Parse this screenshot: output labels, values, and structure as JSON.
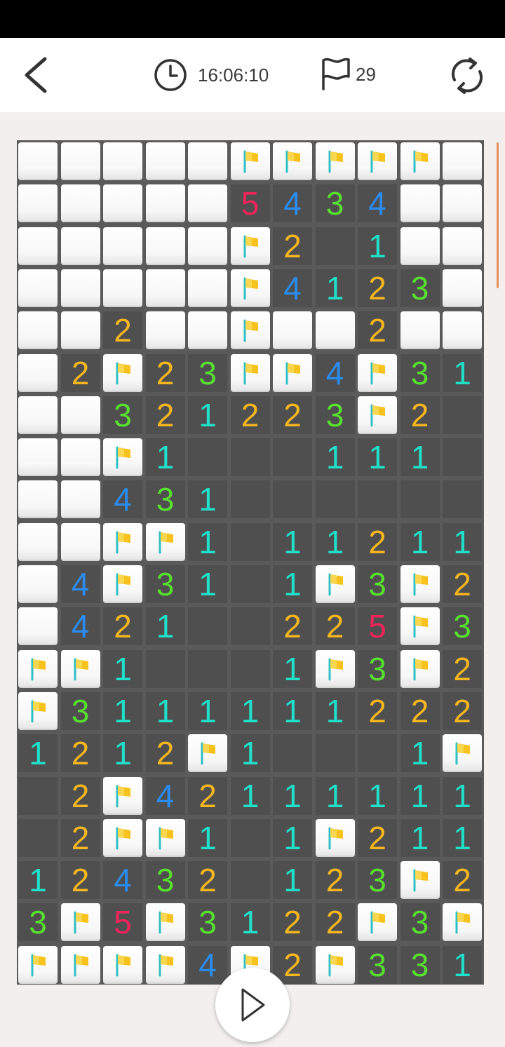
{
  "header": {
    "timer": "16:06:10",
    "flags_count": "29"
  },
  "colors": {
    "1": "#1fe0c9",
    "2": "#f5b61e",
    "3": "#57e02e",
    "4": "#2a8cf0",
    "5": "#f0245a",
    "flag": "#f7c21c",
    "open_cell": "#4f4f4f",
    "grid_line": "#5a5a5a"
  },
  "board": {
    "rows": [
      [
        "H",
        "H",
        "H",
        "H",
        "H",
        "F",
        "F",
        "F",
        "F",
        "F",
        "H"
      ],
      [
        "H",
        "H",
        "H",
        "H",
        "H",
        "5",
        "4",
        "3",
        "4",
        "H",
        "H"
      ],
      [
        "H",
        "H",
        "H",
        "H",
        "H",
        "F",
        "2",
        "0",
        "1",
        "H",
        "H"
      ],
      [
        "H",
        "H",
        "H",
        "H",
        "H",
        "F",
        "4",
        "1",
        "2",
        "3",
        "H"
      ],
      [
        "H",
        "H",
        "2",
        "H",
        "H",
        "F",
        "H",
        "H",
        "2",
        "H",
        "H"
      ],
      [
        "H",
        "2",
        "F",
        "2",
        "3",
        "F",
        "F",
        "4",
        "F",
        "3",
        "1"
      ],
      [
        "H",
        "H",
        "3",
        "2",
        "1",
        "2",
        "2",
        "3",
        "F",
        "2",
        "0"
      ],
      [
        "H",
        "H",
        "F",
        "1",
        "0",
        "0",
        "0",
        "1",
        "1",
        "1",
        "0"
      ],
      [
        "H",
        "H",
        "4",
        "3",
        "1",
        "0",
        "0",
        "0",
        "0",
        "0",
        "0"
      ],
      [
        "H",
        "H",
        "F",
        "F",
        "1",
        "0",
        "1",
        "1",
        "2",
        "1",
        "1"
      ],
      [
        "H",
        "4",
        "F",
        "3",
        "1",
        "0",
        "1",
        "F",
        "3",
        "F",
        "2"
      ],
      [
        "H",
        "4",
        "2",
        "1",
        "0",
        "0",
        "2",
        "2",
        "5",
        "F",
        "3"
      ],
      [
        "F",
        "F",
        "1",
        "0",
        "0",
        "0",
        "1",
        "F",
        "3",
        "F",
        "2"
      ],
      [
        "F",
        "3",
        "1",
        "1",
        "1",
        "1",
        "1",
        "1",
        "2",
        "2",
        "2"
      ],
      [
        "1",
        "2",
        "1",
        "2",
        "F",
        "1",
        "0",
        "0",
        "0",
        "1",
        "F"
      ],
      [
        "0",
        "2",
        "F",
        "4",
        "2",
        "1",
        "1",
        "1",
        "1",
        "1",
        "1"
      ],
      [
        "0",
        "2",
        "F",
        "F",
        "1",
        "0",
        "1",
        "F",
        "2",
        "1",
        "1"
      ],
      [
        "1",
        "2",
        "4",
        "3",
        "2",
        "0",
        "1",
        "2",
        "3",
        "F",
        "2"
      ],
      [
        "3",
        "F",
        "5",
        "F",
        "3",
        "1",
        "2",
        "2",
        "F",
        "3",
        "F"
      ],
      [
        "F",
        "F",
        "F",
        "F",
        "4",
        "F",
        "2",
        "F",
        "3",
        "3",
        "1"
      ]
    ]
  }
}
